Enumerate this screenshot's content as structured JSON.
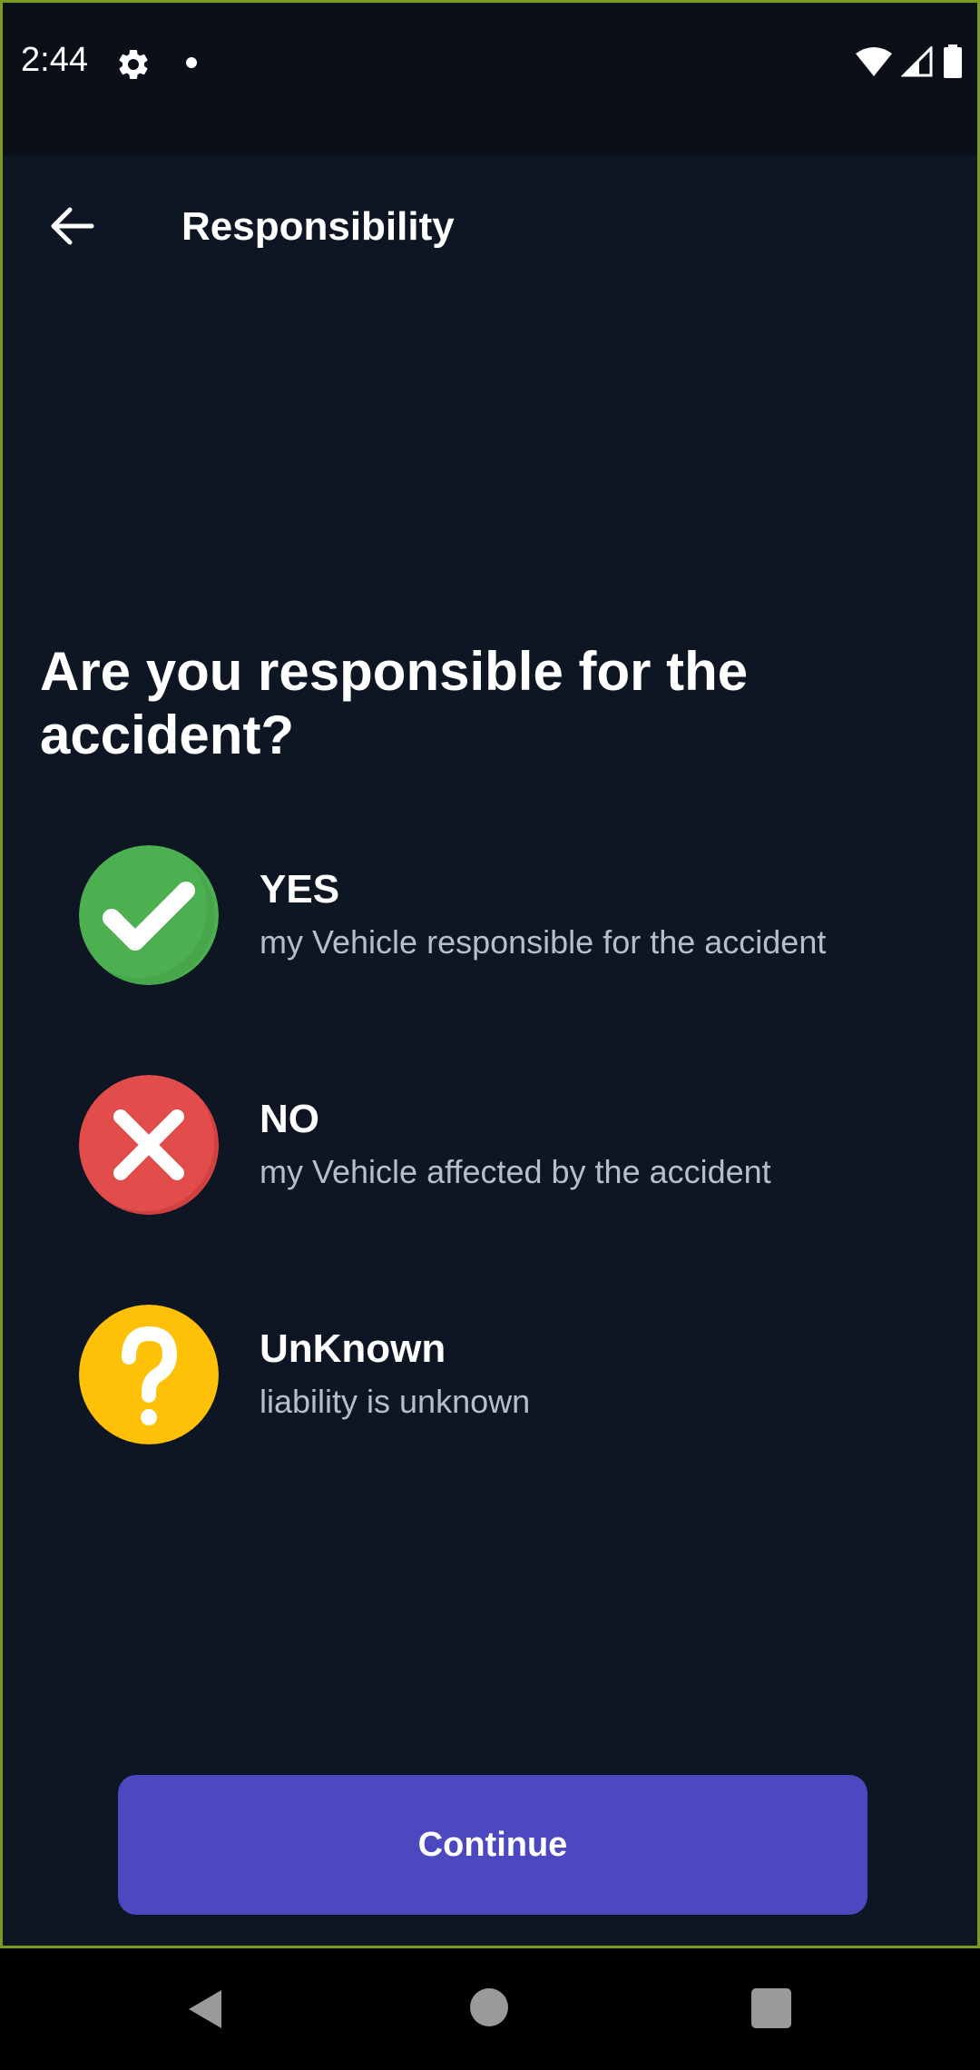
{
  "status_bar": {
    "time": "2:44",
    "icons": [
      "gear-icon",
      "notification-dot-icon",
      "wifi-icon",
      "signal-icon",
      "battery-icon"
    ]
  },
  "toolbar": {
    "title": "Responsibility",
    "back_icon": "arrow-left-icon"
  },
  "question": "Are you responsible for the accident?",
  "options": [
    {
      "title": "YES",
      "subtitle": "my Vehicle responsible for the accident",
      "icon": "check-icon",
      "color": "#4caf50"
    },
    {
      "title": "NO",
      "subtitle": "my Vehicle affected by the accident",
      "icon": "close-icon",
      "color": "#e24c4b"
    },
    {
      "title": "UnKnown",
      "subtitle": "liability is unknown",
      "icon": "question-icon",
      "color": "#ffc107"
    }
  ],
  "continue_label": "Continue",
  "colors": {
    "background": "#0e1623",
    "status_bar": "#0a0f18",
    "primary_button": "#4b48c0",
    "subtitle_text": "#b9bdc7"
  },
  "nav_bar": {
    "icons": [
      "nav-back-icon",
      "nav-home-icon",
      "nav-recents-icon"
    ]
  }
}
